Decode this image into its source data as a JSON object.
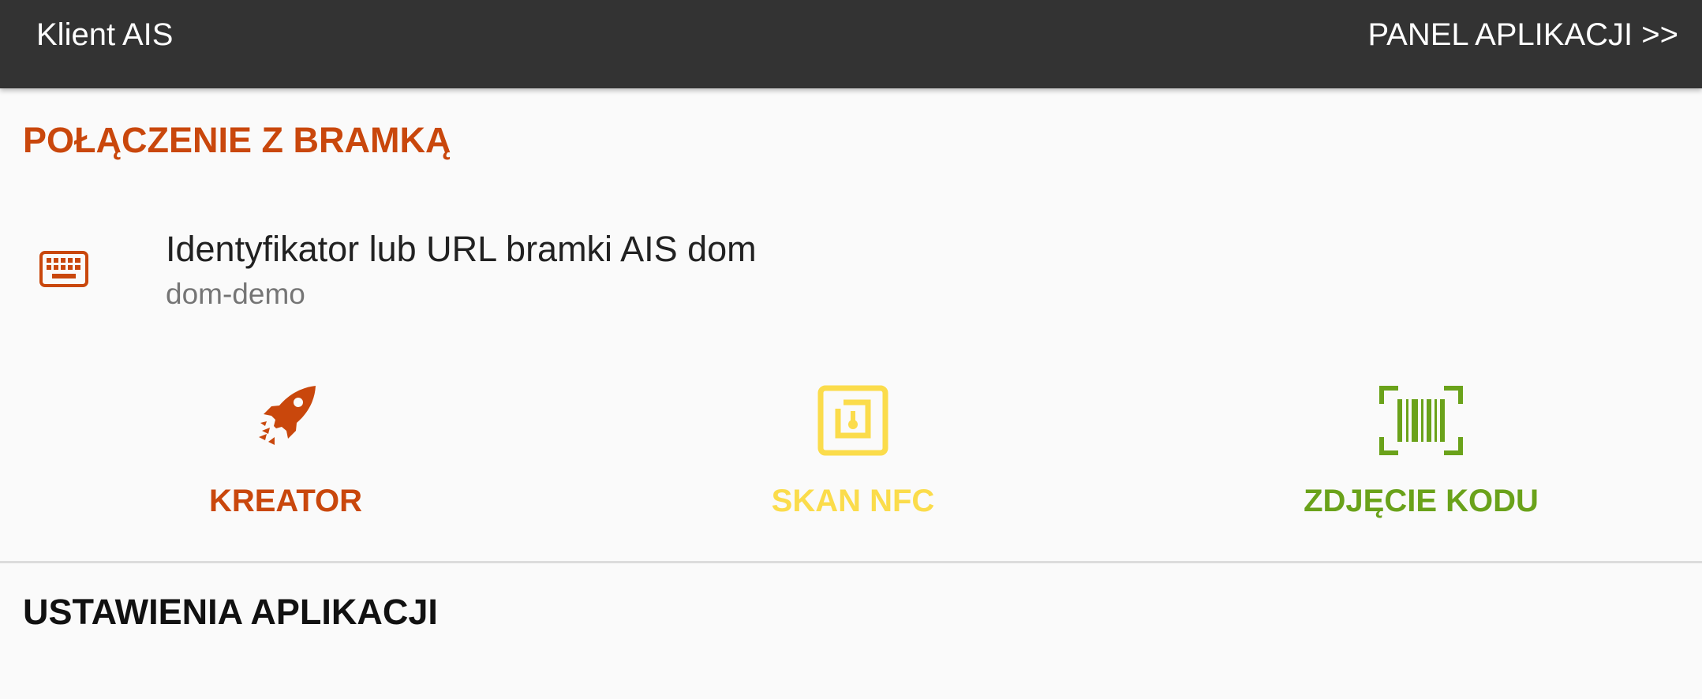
{
  "appbar": {
    "title": "Klient AIS",
    "action_label": "PANEL APLIKACJI >>",
    "background": "#333333"
  },
  "connection_section": {
    "header": "POŁĄCZENIE Z BRAMKĄ",
    "header_color": "#c9470c",
    "gateway_pref": {
      "icon": "keyboard-icon",
      "title": "Identyfikator lub URL bramki AIS dom",
      "summary": "dom-demo"
    },
    "actions": [
      {
        "label": "KREATOR",
        "icon": "rocket-icon",
        "color": "#c9470c"
      },
      {
        "label": "SKAN NFC",
        "icon": "nfc-icon",
        "color": "#fbdc4b"
      },
      {
        "label": "ZDJĘCIE KODU",
        "icon": "barcode-scan-icon",
        "color": "#6aa21a"
      }
    ]
  },
  "settings_section": {
    "header": "USTAWIENIA APLIKACJI"
  }
}
